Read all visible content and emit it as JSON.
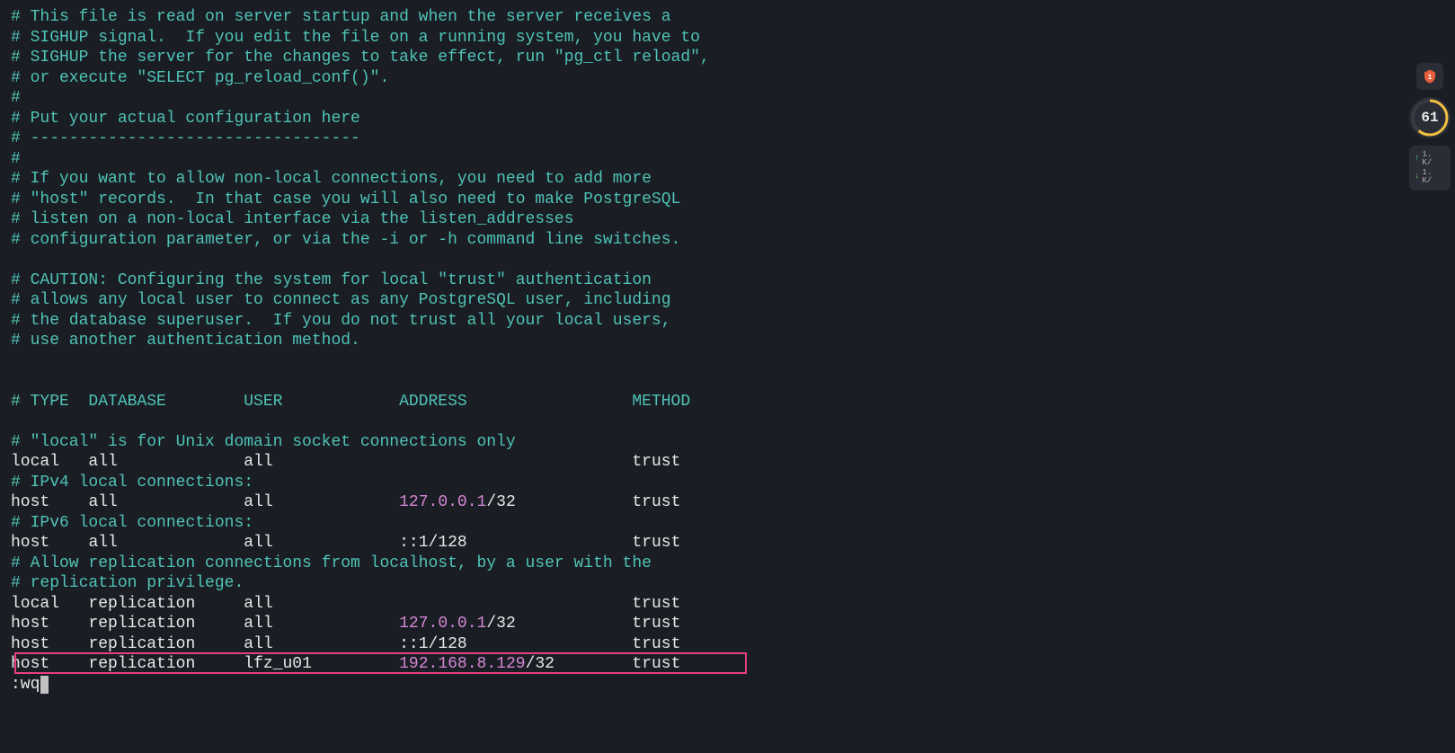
{
  "comments": {
    "line1": "# This file is read on server startup and when the server receives a",
    "line2": "# SIGHUP signal.  If you edit the file on a running system, you have to",
    "line3": "# SIGHUP the server for the changes to take effect, run \"pg_ctl reload\",",
    "line4": "# or execute \"SELECT pg_reload_conf()\".",
    "line5": "#",
    "line6": "# Put your actual configuration here",
    "line7": "# ----------------------------------",
    "line8": "#",
    "line9": "# If you want to allow non-local connections, you need to add more",
    "line10": "# \"host\" records.  In that case you will also need to make PostgreSQL",
    "line11": "# listen on a non-local interface via the listen_addresses",
    "line12": "# configuration parameter, or via the -i or -h command line switches.",
    "line13": "# CAUTION: Configuring the system for local \"trust\" authentication",
    "line14": "# allows any local user to connect as any PostgreSQL user, including",
    "line15": "# the database superuser.  If you do not trust all your local users,",
    "line16": "# use another authentication method.",
    "header": "# TYPE  DATABASE        USER            ADDRESS                 METHOD",
    "local_comment": "# \"local\" is for Unix domain socket connections only",
    "ipv4_comment": "# IPv4 local connections:",
    "ipv6_comment": "# IPv6 local connections:",
    "repl_comment1": "# Allow replication connections from localhost, by a user with the",
    "repl_comment2": "# replication privilege."
  },
  "rules": {
    "r1": {
      "type": "local",
      "db": "all",
      "user": "all",
      "addr": "",
      "method": "trust"
    },
    "r2": {
      "type": "host",
      "db": "all",
      "user": "all",
      "addr_ip": "127.0.0.1",
      "addr_suffix": "/32",
      "method": "trust"
    },
    "r3": {
      "type": "host",
      "db": "all",
      "user": "all",
      "addr": "::1/128",
      "method": "trust"
    },
    "r4": {
      "type": "local",
      "db": "replication",
      "user": "all",
      "addr": "",
      "method": "trust"
    },
    "r5": {
      "type": "host",
      "db": "replication",
      "user": "all",
      "addr_ip": "127.0.0.1",
      "addr_suffix": "/32",
      "method": "trust"
    },
    "r6": {
      "type": "host",
      "db": "replication",
      "user": "all",
      "addr": "::1/128",
      "method": "trust"
    },
    "r7": {
      "type": "host",
      "db": "replication",
      "user": "lfz_u01",
      "addr_ip": "192.168.8.129",
      "addr_suffix": "/32",
      "method": "trust"
    }
  },
  "command": ":wq",
  "side": {
    "shield_count": "1",
    "perf_score": "61",
    "net_up": "1.",
    "net_up_unit": "K/",
    "net_down": "1.",
    "net_down_unit": "K/"
  }
}
